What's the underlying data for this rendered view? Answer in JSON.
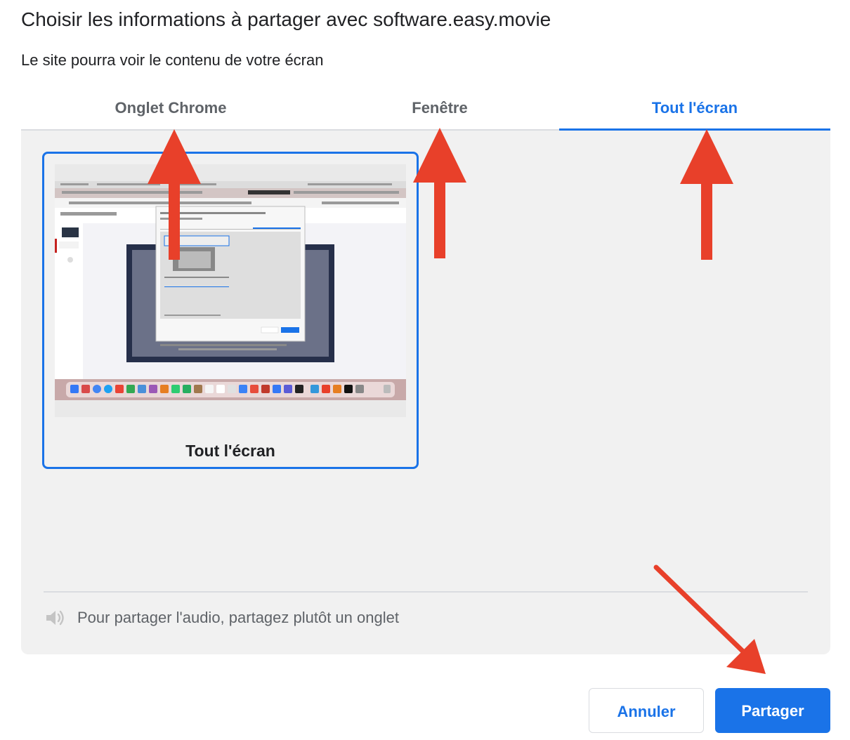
{
  "dialog": {
    "title": "Choisir les informations à partager avec software.easy.movie",
    "subtitle": "Le site pourra voir le contenu de votre écran"
  },
  "tabs": [
    {
      "label": "Onglet Chrome",
      "selected": false
    },
    {
      "label": "Fenêtre",
      "selected": false
    },
    {
      "label": "Tout l'écran",
      "selected": true
    }
  ],
  "sources": [
    {
      "label": "Tout l'écran",
      "selected": true
    }
  ],
  "audio_note": "Pour partager l'audio, partagez plutôt un onglet",
  "buttons": {
    "cancel": "Annuler",
    "share": "Partager"
  },
  "colors": {
    "accent": "#1a73e8",
    "annotation_arrow": "#e8402a"
  },
  "icons": {
    "audio": "speaker-icon"
  }
}
